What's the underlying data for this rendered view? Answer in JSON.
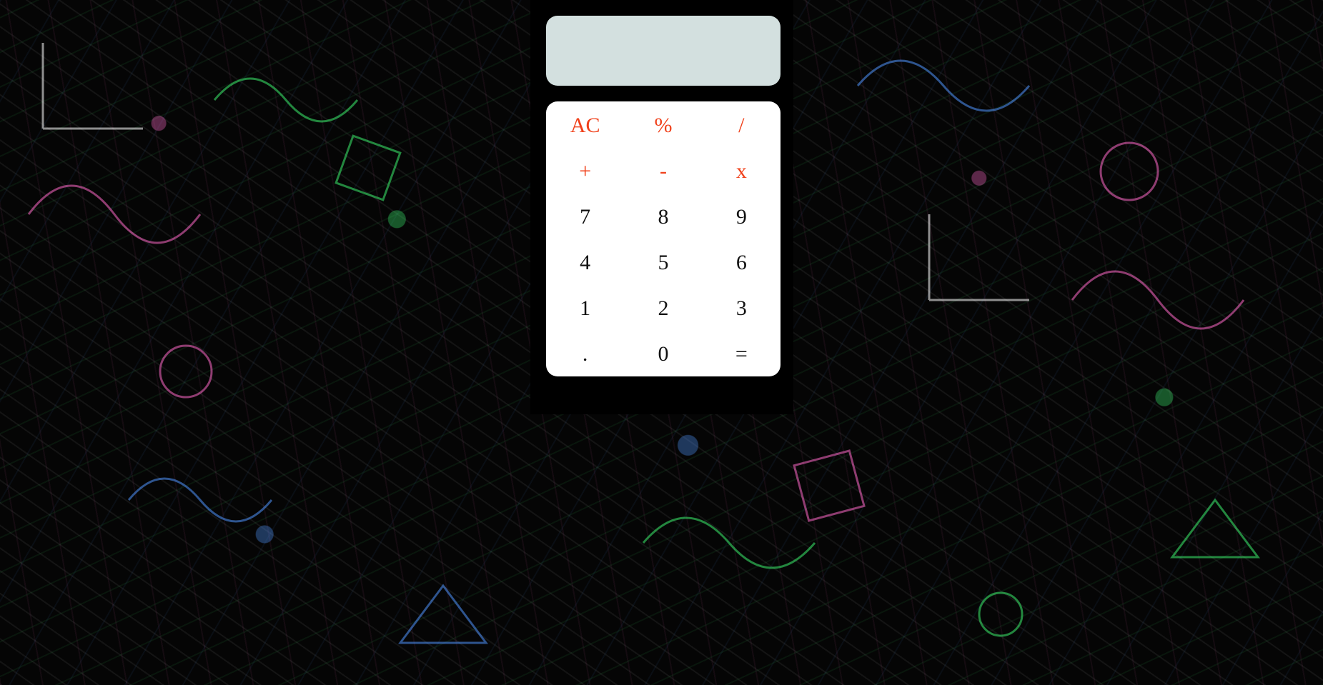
{
  "display": {
    "value": ""
  },
  "keypad": {
    "rows": [
      [
        {
          "label": "AC",
          "type": "op",
          "name": "clear-button"
        },
        {
          "label": "%",
          "type": "op",
          "name": "percent-button"
        },
        {
          "label": "/",
          "type": "op",
          "name": "divide-button"
        }
      ],
      [
        {
          "label": "+",
          "type": "op",
          "name": "add-button"
        },
        {
          "label": "-",
          "type": "op",
          "name": "subtract-button"
        },
        {
          "label": "x",
          "type": "op",
          "name": "multiply-button"
        }
      ],
      [
        {
          "label": "7",
          "type": "num",
          "name": "digit-7-button"
        },
        {
          "label": "8",
          "type": "num",
          "name": "digit-8-button"
        },
        {
          "label": "9",
          "type": "num",
          "name": "digit-9-button"
        }
      ],
      [
        {
          "label": "4",
          "type": "num",
          "name": "digit-4-button"
        },
        {
          "label": "5",
          "type": "num",
          "name": "digit-5-button"
        },
        {
          "label": "6",
          "type": "num",
          "name": "digit-6-button"
        }
      ],
      [
        {
          "label": "1",
          "type": "num",
          "name": "digit-1-button"
        },
        {
          "label": "2",
          "type": "num",
          "name": "digit-2-button"
        },
        {
          "label": "3",
          "type": "num",
          "name": "digit-3-button"
        }
      ],
      [
        {
          "label": ".",
          "type": "num",
          "name": "decimal-button"
        },
        {
          "label": "0",
          "type": "num",
          "name": "digit-0-button"
        },
        {
          "label": "=",
          "type": "num",
          "name": "equals-button"
        }
      ]
    ]
  },
  "colors": {
    "operator": "#f0401a",
    "digit": "#111111",
    "display_bg": "#d3e0df",
    "keypad_bg": "#ffffff"
  },
  "background": {
    "icon": "math-formulas-pattern"
  }
}
